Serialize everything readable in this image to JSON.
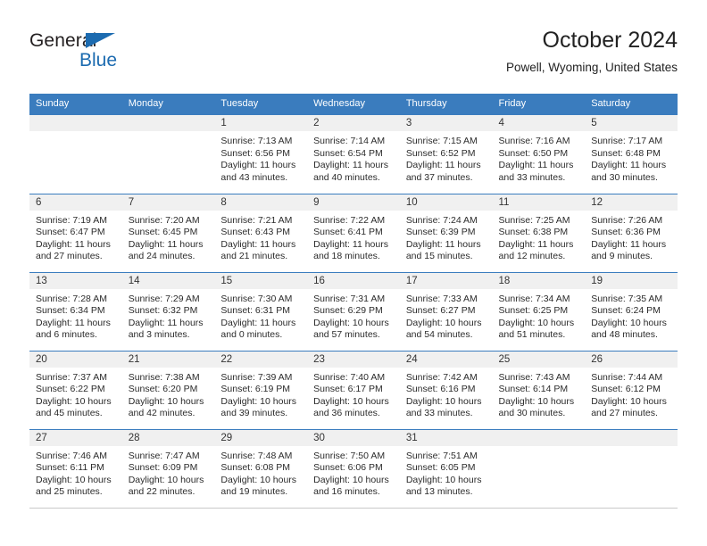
{
  "logo": {
    "word_one": "General",
    "word_two": "Blue",
    "triangle_color": "#1c6bb0"
  },
  "header": {
    "title": "October 2024",
    "subtitle": "Powell, Wyoming, United States"
  },
  "calendar": {
    "header_color": "#3a7cbe",
    "weekday_headers": [
      "Sunday",
      "Monday",
      "Tuesday",
      "Wednesday",
      "Thursday",
      "Friday",
      "Saturday"
    ],
    "weeks": [
      [
        {
          "day": "",
          "sunrise": "",
          "sunset": "",
          "daylight_line1": "",
          "daylight_line2": ""
        },
        {
          "day": "",
          "sunrise": "",
          "sunset": "",
          "daylight_line1": "",
          "daylight_line2": ""
        },
        {
          "day": "1",
          "sunrise": "Sunrise: 7:13 AM",
          "sunset": "Sunset: 6:56 PM",
          "daylight_line1": "Daylight: 11 hours",
          "daylight_line2": "and 43 minutes."
        },
        {
          "day": "2",
          "sunrise": "Sunrise: 7:14 AM",
          "sunset": "Sunset: 6:54 PM",
          "daylight_line1": "Daylight: 11 hours",
          "daylight_line2": "and 40 minutes."
        },
        {
          "day": "3",
          "sunrise": "Sunrise: 7:15 AM",
          "sunset": "Sunset: 6:52 PM",
          "daylight_line1": "Daylight: 11 hours",
          "daylight_line2": "and 37 minutes."
        },
        {
          "day": "4",
          "sunrise": "Sunrise: 7:16 AM",
          "sunset": "Sunset: 6:50 PM",
          "daylight_line1": "Daylight: 11 hours",
          "daylight_line2": "and 33 minutes."
        },
        {
          "day": "5",
          "sunrise": "Sunrise: 7:17 AM",
          "sunset": "Sunset: 6:48 PM",
          "daylight_line1": "Daylight: 11 hours",
          "daylight_line2": "and 30 minutes."
        }
      ],
      [
        {
          "day": "6",
          "sunrise": "Sunrise: 7:19 AM",
          "sunset": "Sunset: 6:47 PM",
          "daylight_line1": "Daylight: 11 hours",
          "daylight_line2": "and 27 minutes."
        },
        {
          "day": "7",
          "sunrise": "Sunrise: 7:20 AM",
          "sunset": "Sunset: 6:45 PM",
          "daylight_line1": "Daylight: 11 hours",
          "daylight_line2": "and 24 minutes."
        },
        {
          "day": "8",
          "sunrise": "Sunrise: 7:21 AM",
          "sunset": "Sunset: 6:43 PM",
          "daylight_line1": "Daylight: 11 hours",
          "daylight_line2": "and 21 minutes."
        },
        {
          "day": "9",
          "sunrise": "Sunrise: 7:22 AM",
          "sunset": "Sunset: 6:41 PM",
          "daylight_line1": "Daylight: 11 hours",
          "daylight_line2": "and 18 minutes."
        },
        {
          "day": "10",
          "sunrise": "Sunrise: 7:24 AM",
          "sunset": "Sunset: 6:39 PM",
          "daylight_line1": "Daylight: 11 hours",
          "daylight_line2": "and 15 minutes."
        },
        {
          "day": "11",
          "sunrise": "Sunrise: 7:25 AM",
          "sunset": "Sunset: 6:38 PM",
          "daylight_line1": "Daylight: 11 hours",
          "daylight_line2": "and 12 minutes."
        },
        {
          "day": "12",
          "sunrise": "Sunrise: 7:26 AM",
          "sunset": "Sunset: 6:36 PM",
          "daylight_line1": "Daylight: 11 hours",
          "daylight_line2": "and 9 minutes."
        }
      ],
      [
        {
          "day": "13",
          "sunrise": "Sunrise: 7:28 AM",
          "sunset": "Sunset: 6:34 PM",
          "daylight_line1": "Daylight: 11 hours",
          "daylight_line2": "and 6 minutes."
        },
        {
          "day": "14",
          "sunrise": "Sunrise: 7:29 AM",
          "sunset": "Sunset: 6:32 PM",
          "daylight_line1": "Daylight: 11 hours",
          "daylight_line2": "and 3 minutes."
        },
        {
          "day": "15",
          "sunrise": "Sunrise: 7:30 AM",
          "sunset": "Sunset: 6:31 PM",
          "daylight_line1": "Daylight: 11 hours",
          "daylight_line2": "and 0 minutes."
        },
        {
          "day": "16",
          "sunrise": "Sunrise: 7:31 AM",
          "sunset": "Sunset: 6:29 PM",
          "daylight_line1": "Daylight: 10 hours",
          "daylight_line2": "and 57 minutes."
        },
        {
          "day": "17",
          "sunrise": "Sunrise: 7:33 AM",
          "sunset": "Sunset: 6:27 PM",
          "daylight_line1": "Daylight: 10 hours",
          "daylight_line2": "and 54 minutes."
        },
        {
          "day": "18",
          "sunrise": "Sunrise: 7:34 AM",
          "sunset": "Sunset: 6:25 PM",
          "daylight_line1": "Daylight: 10 hours",
          "daylight_line2": "and 51 minutes."
        },
        {
          "day": "19",
          "sunrise": "Sunrise: 7:35 AM",
          "sunset": "Sunset: 6:24 PM",
          "daylight_line1": "Daylight: 10 hours",
          "daylight_line2": "and 48 minutes."
        }
      ],
      [
        {
          "day": "20",
          "sunrise": "Sunrise: 7:37 AM",
          "sunset": "Sunset: 6:22 PM",
          "daylight_line1": "Daylight: 10 hours",
          "daylight_line2": "and 45 minutes."
        },
        {
          "day": "21",
          "sunrise": "Sunrise: 7:38 AM",
          "sunset": "Sunset: 6:20 PM",
          "daylight_line1": "Daylight: 10 hours",
          "daylight_line2": "and 42 minutes."
        },
        {
          "day": "22",
          "sunrise": "Sunrise: 7:39 AM",
          "sunset": "Sunset: 6:19 PM",
          "daylight_line1": "Daylight: 10 hours",
          "daylight_line2": "and 39 minutes."
        },
        {
          "day": "23",
          "sunrise": "Sunrise: 7:40 AM",
          "sunset": "Sunset: 6:17 PM",
          "daylight_line1": "Daylight: 10 hours",
          "daylight_line2": "and 36 minutes."
        },
        {
          "day": "24",
          "sunrise": "Sunrise: 7:42 AM",
          "sunset": "Sunset: 6:16 PM",
          "daylight_line1": "Daylight: 10 hours",
          "daylight_line2": "and 33 minutes."
        },
        {
          "day": "25",
          "sunrise": "Sunrise: 7:43 AM",
          "sunset": "Sunset: 6:14 PM",
          "daylight_line1": "Daylight: 10 hours",
          "daylight_line2": "and 30 minutes."
        },
        {
          "day": "26",
          "sunrise": "Sunrise: 7:44 AM",
          "sunset": "Sunset: 6:12 PM",
          "daylight_line1": "Daylight: 10 hours",
          "daylight_line2": "and 27 minutes."
        }
      ],
      [
        {
          "day": "27",
          "sunrise": "Sunrise: 7:46 AM",
          "sunset": "Sunset: 6:11 PM",
          "daylight_line1": "Daylight: 10 hours",
          "daylight_line2": "and 25 minutes."
        },
        {
          "day": "28",
          "sunrise": "Sunrise: 7:47 AM",
          "sunset": "Sunset: 6:09 PM",
          "daylight_line1": "Daylight: 10 hours",
          "daylight_line2": "and 22 minutes."
        },
        {
          "day": "29",
          "sunrise": "Sunrise: 7:48 AM",
          "sunset": "Sunset: 6:08 PM",
          "daylight_line1": "Daylight: 10 hours",
          "daylight_line2": "and 19 minutes."
        },
        {
          "day": "30",
          "sunrise": "Sunrise: 7:50 AM",
          "sunset": "Sunset: 6:06 PM",
          "daylight_line1": "Daylight: 10 hours",
          "daylight_line2": "and 16 minutes."
        },
        {
          "day": "31",
          "sunrise": "Sunrise: 7:51 AM",
          "sunset": "Sunset: 6:05 PM",
          "daylight_line1": "Daylight: 10 hours",
          "daylight_line2": "and 13 minutes."
        },
        {
          "day": "",
          "sunrise": "",
          "sunset": "",
          "daylight_line1": "",
          "daylight_line2": ""
        },
        {
          "day": "",
          "sunrise": "",
          "sunset": "",
          "daylight_line1": "",
          "daylight_line2": ""
        }
      ]
    ]
  }
}
